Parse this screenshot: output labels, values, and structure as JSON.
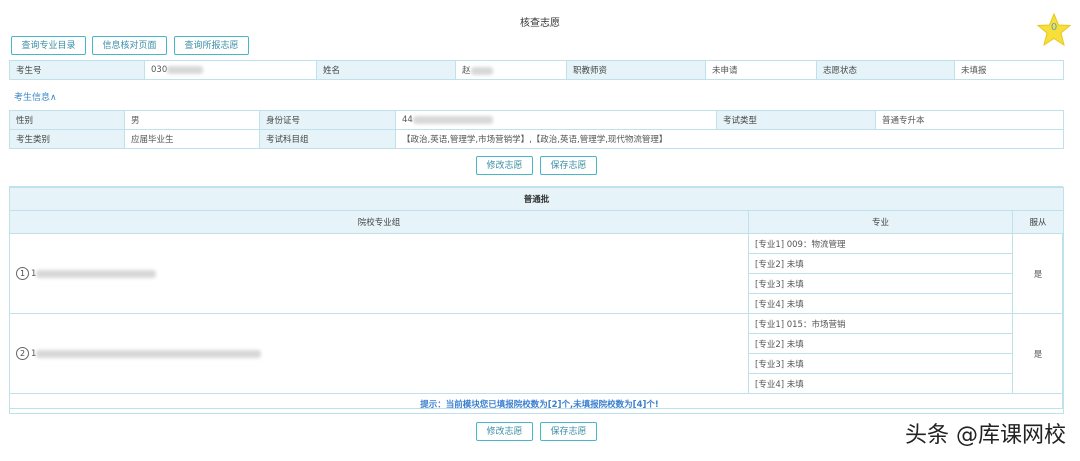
{
  "page": {
    "title": "核查志愿"
  },
  "star": {
    "count": "0"
  },
  "toolbar": {
    "btn1": "查询专业目录",
    "btn2": "信息核对页面",
    "btn3": "查询所报志愿"
  },
  "info_row": {
    "exam_no_label": "考生号",
    "exam_no_value": "030",
    "name_label": "姓名",
    "name_value": "赵",
    "title_label": "职教师资",
    "title_value": "未申请",
    "status_label": "志愿状态",
    "status_value": "未填报"
  },
  "toggle_link": "考生信息∧",
  "detail": {
    "gender_label": "性别",
    "gender_value": "男",
    "id_label": "身份证号",
    "id_value": "44",
    "exam_type_label": "考试类型",
    "exam_type_value": "普通专升本",
    "category_label": "考生类别",
    "category_value": "应届毕业生",
    "subject_label": "考试科目组",
    "subject_value": "【政治,英语,管理学,市场营销学】,【政治,英语,管理学,现代物流管理】"
  },
  "actions": {
    "modify": "修改志愿",
    "save": "保存志愿"
  },
  "volunteer": {
    "batch": "普通批",
    "col_group": "院校专业组",
    "col_major": "专业",
    "col_obey": "服从",
    "groups": [
      {
        "index": "1",
        "prefix": "1",
        "obey": "是",
        "majors": [
          "[专业1] 009：物流管理",
          "[专业2] 未填",
          "[专业3] 未填",
          "[专业4] 未填"
        ]
      },
      {
        "index": "2",
        "prefix": "1",
        "obey": "是",
        "majors": [
          "[专业1] 015：市场营销",
          "[专业2] 未填",
          "[专业3] 未填",
          "[专业4] 未填"
        ]
      }
    ],
    "hint": "提示：当前模块您已填报院校数为[2]个,未填报院校数为[4]个!"
  },
  "watermark": "头条 @库课网校"
}
